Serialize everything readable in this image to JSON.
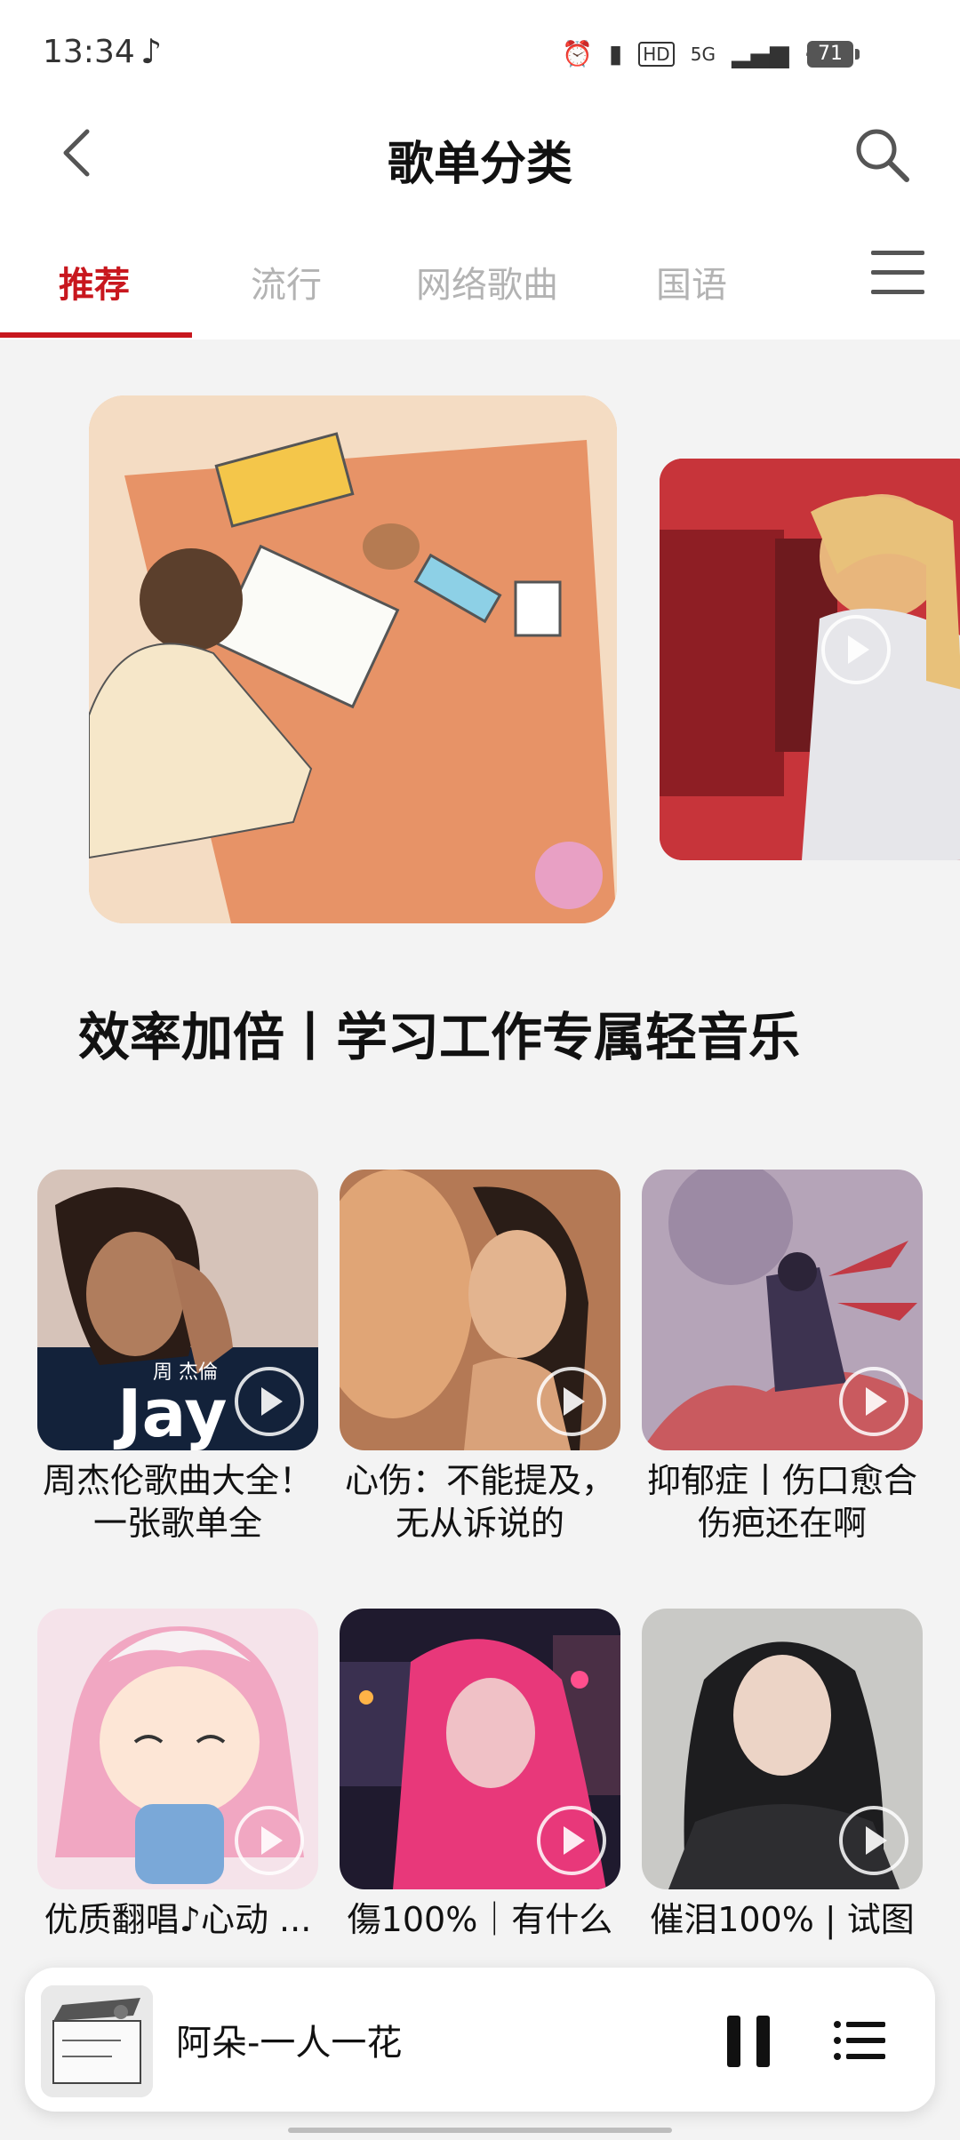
{
  "status_bar": {
    "time": "13:34",
    "battery": "71",
    "network": "5G",
    "hd": "HD"
  },
  "header": {
    "title": "歌单分类"
  },
  "tabs": [
    {
      "label": "推荐",
      "active": true
    },
    {
      "label": "流行",
      "active": false
    },
    {
      "label": "网络歌曲",
      "active": false
    },
    {
      "label": "国语",
      "active": false
    }
  ],
  "banner": {
    "title": "效率加倍丨学习工作专属轻音乐"
  },
  "playlists": [
    {
      "title": "周杰伦歌曲大全！一张歌单全",
      "cover_text": "周 杰倫"
    },
    {
      "title": "心伤：不能提及，无从诉说的"
    },
    {
      "title": "抑郁症丨伤口愈合伤疤还在啊"
    },
    {
      "title": "优质翻唱♪心动 ..."
    },
    {
      "title": "傷100%｜有什么 ..."
    },
    {
      "title": "催泪100% | 试图 ..."
    }
  ],
  "player": {
    "song": "阿朵-一人一花"
  },
  "colors": {
    "accent": "#c8171e",
    "inactive_tab": "#b3b3b3",
    "background": "#f3f3f3"
  },
  "icons": {
    "back": "chevron-left-icon",
    "search": "search-icon",
    "menu": "menu-icon",
    "pause": "pause-icon",
    "playlist": "list-icon"
  }
}
